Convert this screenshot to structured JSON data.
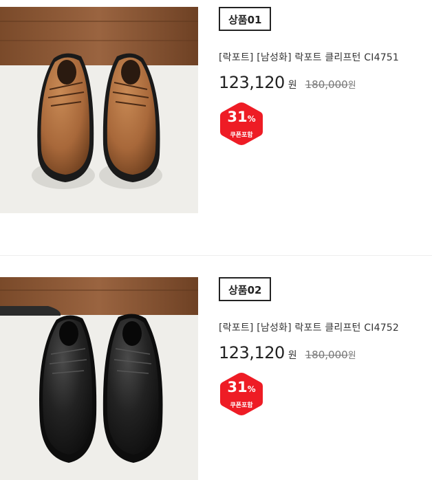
{
  "products": [
    {
      "badge": "상품01",
      "name": "[락포트] [남성화] 락포트 클리프턴 CI4751",
      "price": "123,120",
      "price_unit": "원",
      "original_price": "180,000",
      "original_unit": "원",
      "discount_percent": "31",
      "discount_symbol": "%",
      "discount_note": "쿠폰포함",
      "shoe_color": "#a8683a"
    },
    {
      "badge": "상품02",
      "name": "[락포트] [남성화] 락포트 클리프턴 CI4752",
      "price": "123,120",
      "price_unit": "원",
      "original_price": "180,000",
      "original_unit": "원",
      "discount_percent": "31",
      "discount_symbol": "%",
      "discount_note": "쿠폰포함",
      "shoe_color": "#1c1c1c"
    }
  ],
  "colors": {
    "discount_badge": "#ee1c25",
    "text": "#222222",
    "muted": "#777777"
  }
}
